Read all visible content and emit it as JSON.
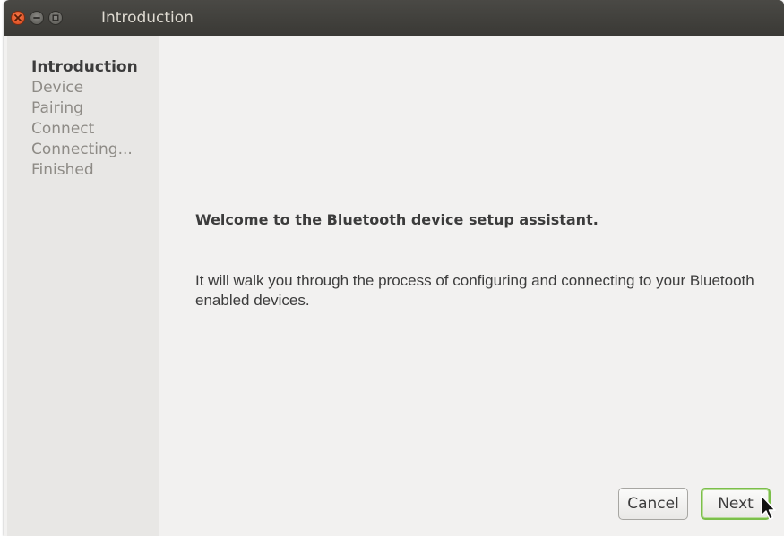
{
  "window": {
    "title": "Introduction",
    "controls": [
      "close-icon",
      "minimize-icon",
      "maximize-icon"
    ]
  },
  "sidebar": {
    "steps": [
      {
        "label": "Introduction",
        "active": true
      },
      {
        "label": "Device",
        "active": false
      },
      {
        "label": "Pairing",
        "active": false
      },
      {
        "label": "Connect",
        "active": false
      },
      {
        "label": "Connecting...",
        "active": false
      },
      {
        "label": "Finished",
        "active": false
      }
    ]
  },
  "main": {
    "heading": "Welcome to the Bluetooth device setup assistant.",
    "body": "It will walk you through the process of configuring and connecting to your Bluetooth enabled devices."
  },
  "buttons": {
    "cancel_label": "Cancel",
    "next_label": "Next"
  },
  "colors": {
    "titlebar": "#3c3b37",
    "close_button": "#e9581e",
    "window_background": "#f2f1f0",
    "sidebar_background": "#e8e7e5",
    "default_button_focus": "#7bbf4a"
  }
}
